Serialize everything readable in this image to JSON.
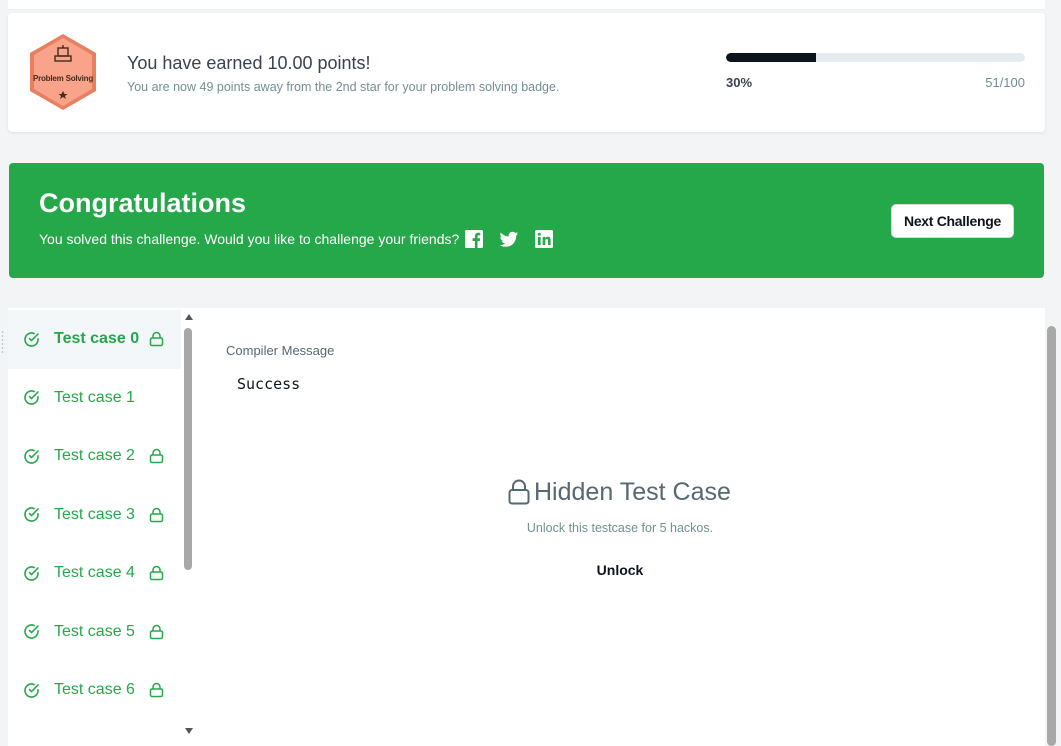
{
  "points_card": {
    "badge_label": "Problem Solving",
    "title": "You have earned 10.00 points!",
    "subtitle": "You are now 49 points away from the 2nd star for your problem solving badge.",
    "progress_percent": 30,
    "progress_label": "30%",
    "progress_count": "51/100"
  },
  "banner": {
    "title": "Congratulations",
    "subtitle": "You solved this challenge. Would you like to challenge your friends?",
    "next_button": "Next Challenge",
    "social_icons": [
      "facebook-icon",
      "twitter-icon",
      "linkedin-icon"
    ]
  },
  "test_cases": [
    {
      "label": "Test case 0",
      "locked": true,
      "active": true
    },
    {
      "label": "Test case 1",
      "locked": false,
      "active": false
    },
    {
      "label": "Test case 2",
      "locked": true,
      "active": false
    },
    {
      "label": "Test case 3",
      "locked": true,
      "active": false
    },
    {
      "label": "Test case 4",
      "locked": true,
      "active": false
    },
    {
      "label": "Test case 5",
      "locked": true,
      "active": false
    },
    {
      "label": "Test case 6",
      "locked": true,
      "active": false
    }
  ],
  "compiler": {
    "label": "Compiler Message",
    "output": "Success"
  },
  "hidden": {
    "title": "Hidden Test Case",
    "subtitle": "Unlock this testcase for 5 hackos.",
    "unlock_button": "Unlock"
  },
  "colors": {
    "success_green": "#25a84a",
    "progress_dark": "#0e141e",
    "badge_fill": "#f9a48a"
  }
}
